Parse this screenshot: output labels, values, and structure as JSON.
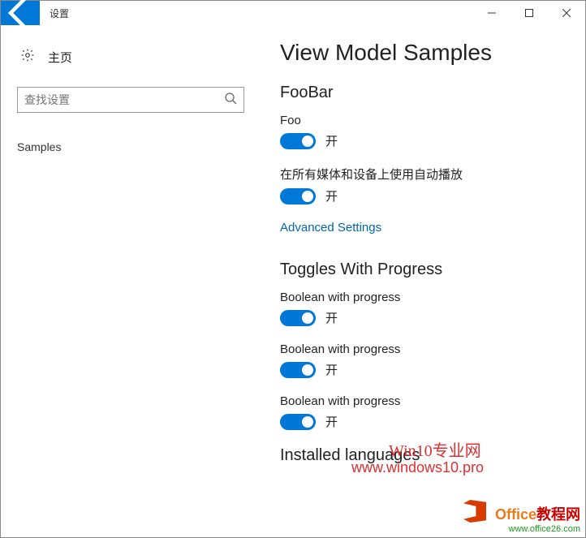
{
  "window": {
    "title": "设置"
  },
  "sidebar": {
    "home": "主页",
    "search_placeholder": "查找设置",
    "items": [
      "Samples"
    ]
  },
  "main": {
    "page_title": "View Model Samples",
    "sections": [
      {
        "heading": "FooBar",
        "toggles": [
          {
            "label": "Foo",
            "state": "开"
          },
          {
            "label": "在所有媒体和设备上使用自动播放",
            "state": "开"
          }
        ],
        "link": "Advanced Settings"
      },
      {
        "heading": "Toggles With Progress",
        "toggles": [
          {
            "label": "Boolean with progress",
            "state": "开"
          },
          {
            "label": "Boolean with progress",
            "state": "开"
          },
          {
            "label": "Boolean with progress",
            "state": "开"
          }
        ]
      },
      {
        "heading": "Installed languages"
      }
    ]
  },
  "watermarks": {
    "line1": "Win10专业网",
    "line2": "www.windows10.pro",
    "brand_prefix": "Office",
    "brand_suffix": "教程网",
    "brand_url": "www.office26.com"
  }
}
